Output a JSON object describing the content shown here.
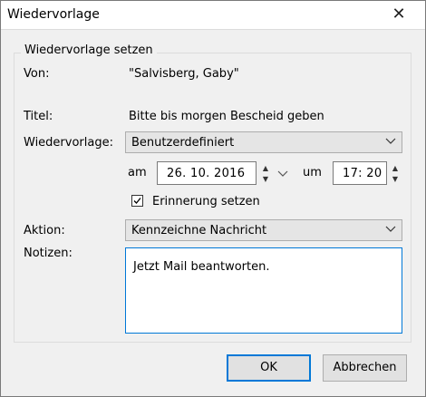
{
  "window": {
    "title": "Wiedervorlage",
    "close_glyph": "✕"
  },
  "group": {
    "legend": "Wiedervorlage setzen"
  },
  "von": {
    "label": "Von:",
    "value": "\"Salvisberg, Gaby\""
  },
  "titel": {
    "label": "Titel:",
    "value": "Bitte bis morgen Bescheid geben"
  },
  "wiedervorlage": {
    "label": "Wiedervorlage:",
    "selected": "Benutzerdefiniert"
  },
  "datetime": {
    "am_label": "am",
    "date": "26. 10.  2016",
    "um_label": "um",
    "time": "17: 20"
  },
  "erinnerung": {
    "label": "Erinnerung setzen",
    "checked": true
  },
  "aktion": {
    "label": "Aktion:",
    "selected": "Kennzeichne Nachricht"
  },
  "notizen": {
    "label": "Notizen:",
    "value": "Jetzt Mail beantworten."
  },
  "buttons": {
    "ok": "OK",
    "cancel": "Abbrechen"
  },
  "colors": {
    "accent": "#0078d7",
    "background": "#f0f0f0"
  }
}
